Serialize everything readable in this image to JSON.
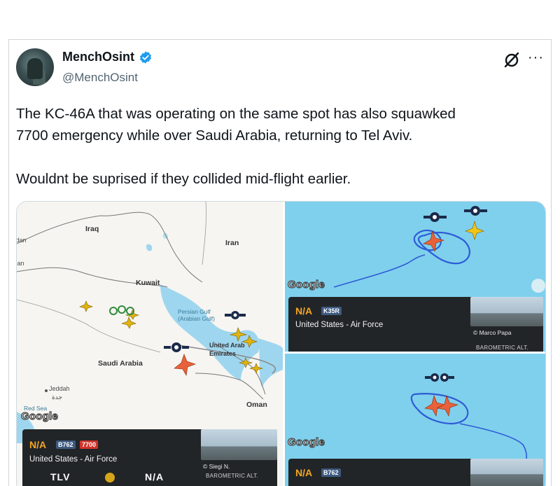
{
  "author": {
    "display_name": "MenchOsint",
    "handle": "@MenchOsint",
    "verified_icon": "verified-badge-icon",
    "verified_color": "#1d9bf0"
  },
  "header_actions": {
    "grok_icon": "grok-icon",
    "more_label": "···"
  },
  "tweet": {
    "text": "The KC-46A that was operating on the same spot has also squawked\n7700 emergency while over Saudi Arabia, returning to Tel Aviv.\n\nWouldnt be suprised if they collided mid-flight earlier."
  },
  "map_left": {
    "labels": {
      "iraq": "Iraq",
      "iran": "Iran",
      "kuwait": "Kuwait",
      "jordan": "Jordan",
      "oman_left": "Oman",
      "saudi": "Saudi Arabia",
      "uae": "United Arab Emirates",
      "oman": "Oman",
      "jeddah": "Jeddah",
      "jeddah_ar": "جدة",
      "red_sea": "Red Sea",
      "gulf": "Persian Gulf (Arabian Gulf)"
    },
    "labels_cut": {
      "jordan": "Jordan",
      "oman_left": "Oman"
    },
    "google": "Google",
    "info": {
      "code": "N/A",
      "type": "B762",
      "squawk": "7700",
      "operator": "United States - Air Force",
      "credit": "© Siegi N.",
      "origin": "TLV",
      "dest": "N/A",
      "alt_label": "BAROMETRIC ALT."
    }
  },
  "map_right_top": {
    "google": "Google",
    "info": {
      "code": "N/A",
      "type": "K35R",
      "operator": "United States - Air Force",
      "credit": "© Marco Papa",
      "alt_label": "BAROMETRIC ALT."
    }
  },
  "map_right_bottom": {
    "google": "Google",
    "info": {
      "code": "N/A",
      "type": "B762"
    }
  },
  "colors": {
    "accent_verified": "#1d9bf0",
    "sea": "#7fd0ec",
    "emergency_plane": "#e8613a",
    "traffic_plane": "#f2c417",
    "track": "#2d5bd6",
    "squawk_badge": "#d0342c"
  }
}
